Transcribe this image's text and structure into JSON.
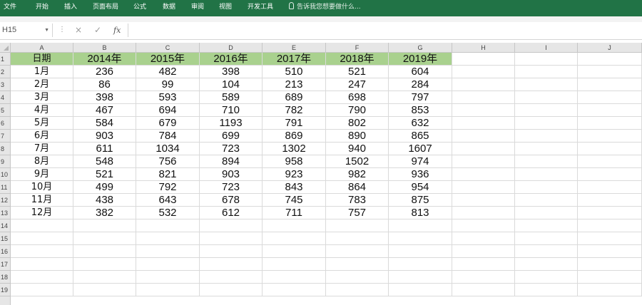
{
  "ribbon": {
    "tabs": [
      "文件",
      "开始",
      "插入",
      "页面布局",
      "公式",
      "数据",
      "审阅",
      "视图",
      "开发工具"
    ],
    "tell_me": "告诉我您想要做什么..."
  },
  "formula_bar": {
    "name_box": "H15",
    "cancel_icon": "×",
    "enter_icon": "✓",
    "fx_label": "fx",
    "content": ""
  },
  "columns": [
    "A",
    "B",
    "C",
    "D",
    "E",
    "F",
    "G",
    "H",
    "I",
    "J"
  ],
  "rows": [
    "1",
    "2",
    "3",
    "4",
    "5",
    "6",
    "7",
    "8",
    "9",
    "10",
    "11",
    "12",
    "13",
    "14",
    "15",
    "16",
    "17",
    "18",
    "19"
  ],
  "table": {
    "header": [
      "日期",
      "2014年",
      "2015年",
      "2016年",
      "2017年",
      "2018年",
      "2019年"
    ],
    "rows": [
      [
        "1月",
        "236",
        "482",
        "398",
        "510",
        "521",
        "604"
      ],
      [
        "2月",
        "86",
        "99",
        "104",
        "213",
        "247",
        "284"
      ],
      [
        "3月",
        "398",
        "593",
        "589",
        "689",
        "698",
        "797"
      ],
      [
        "4月",
        "467",
        "694",
        "710",
        "782",
        "790",
        "853"
      ],
      [
        "5月",
        "584",
        "679",
        "1193",
        "791",
        "802",
        "632"
      ],
      [
        "6月",
        "903",
        "784",
        "699",
        "869",
        "890",
        "865"
      ],
      [
        "7月",
        "611",
        "1034",
        "723",
        "1302",
        "940",
        "1607"
      ],
      [
        "8月",
        "548",
        "756",
        "894",
        "958",
        "1502",
        "974"
      ],
      [
        "9月",
        "521",
        "821",
        "903",
        "923",
        "982",
        "936"
      ],
      [
        "10月",
        "499",
        "792",
        "723",
        "843",
        "864",
        "954"
      ],
      [
        "11月",
        "438",
        "643",
        "678",
        "745",
        "783",
        "875"
      ],
      [
        "12月",
        "382",
        "532",
        "612",
        "711",
        "757",
        "813"
      ]
    ]
  },
  "colors": {
    "ribbon": "#217346",
    "header_fill": "#a9d18e"
  }
}
